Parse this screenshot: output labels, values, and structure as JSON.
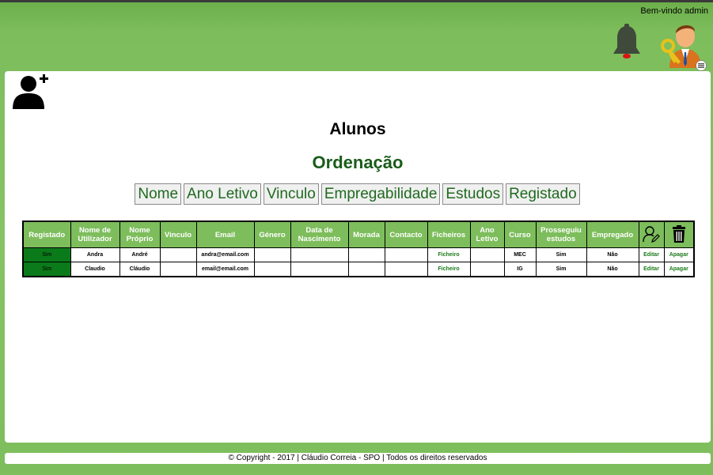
{
  "header": {
    "welcome_text": "Bem-vindo admin",
    "bell_icon": "bell-icon",
    "avatar_icon": "admin-avatar-icon",
    "menu_icon": "menu-icon"
  },
  "page": {
    "add_user_icon": "add-user-icon",
    "title": "Alunos",
    "subtitle": "Ordenação",
    "sort_buttons": [
      "Nome",
      "Ano Letivo",
      "Vinculo",
      "Empregabilidade",
      "Estudos",
      "Registado"
    ]
  },
  "table": {
    "headers": [
      "Registado",
      "Nome de Utilizador",
      "Nome Próprio",
      "Vinculo",
      "Email",
      "Género",
      "Data de Nascimento",
      "Morada",
      "Contacto",
      "Ficheiros",
      "Ano Letivo",
      "Curso",
      "Prosseguiu estudos",
      "Empregado"
    ],
    "edit_header_icon": "edit-user-icon",
    "delete_header_icon": "trash-icon",
    "rows": [
      {
        "registado": "Sim",
        "utilizador": "Andra",
        "nome": "André",
        "vinculo": "",
        "email": "andra@email.com",
        "genero": "",
        "nascimento": "",
        "morada": "",
        "contacto": "",
        "ficheiros": "Ficheiro",
        "ano": "",
        "curso": "MEC",
        "prosseguiu": "Sim",
        "empregado": "Não",
        "editar": "Editar",
        "apagar": "Apagar"
      },
      {
        "registado": "Sim",
        "utilizador": "Claudio",
        "nome": "Cláudio",
        "vinculo": "",
        "email": "email@email.com",
        "genero": "",
        "nascimento": "",
        "morada": "",
        "contacto": "",
        "ficheiros": "Ficheiro",
        "ano": "",
        "curso": "IG",
        "prosseguiu": "Sim",
        "empregado": "Não",
        "editar": "Editar",
        "apagar": "Apagar"
      }
    ]
  },
  "footer": {
    "text": "© Copyright - 2017 | Cláudio Correia - SPO | Todos os direitos reservados"
  },
  "colors": {
    "background": "#7dbd5c",
    "header_cell": "#7dbd5c",
    "registered_cell": "#0b7a1a",
    "accent_text": "#1a5c1a"
  }
}
